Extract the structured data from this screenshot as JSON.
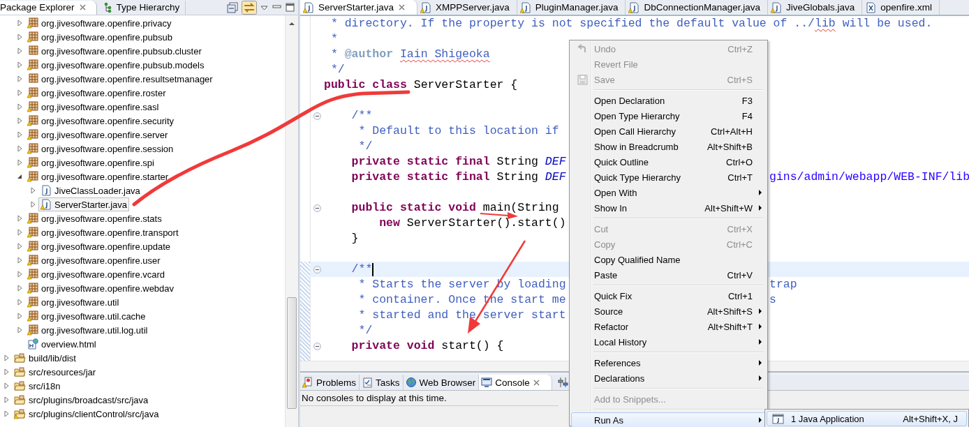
{
  "explorer": {
    "tabs": [
      {
        "label": "Package Explorer",
        "selected": true,
        "closable": true
      },
      {
        "label": "Type Hierarchy",
        "selected": false,
        "closable": false
      }
    ],
    "tree": {
      "continued_children": [
        {
          "kind": "package",
          "label": "org.jivesoftware.openfire.privacy",
          "warning": true,
          "expanded": false,
          "selected": false
        },
        {
          "kind": "package",
          "label": "org.jivesoftware.openfire.pubsub",
          "warning": true,
          "expanded": false,
          "selected": false
        },
        {
          "kind": "package",
          "label": "org.jivesoftware.openfire.pubsub.cluster",
          "warning": false,
          "expanded": false,
          "selected": false
        },
        {
          "kind": "package",
          "label": "org.jivesoftware.openfire.pubsub.models",
          "warning": true,
          "expanded": false,
          "selected": false
        },
        {
          "kind": "package",
          "label": "org.jivesoftware.openfire.resultsetmanager",
          "warning": false,
          "expanded": false,
          "selected": false
        },
        {
          "kind": "package",
          "label": "org.jivesoftware.openfire.roster",
          "warning": true,
          "expanded": false,
          "selected": false
        },
        {
          "kind": "package",
          "label": "org.jivesoftware.openfire.sasl",
          "warning": true,
          "expanded": false,
          "selected": false
        },
        {
          "kind": "package",
          "label": "org.jivesoftware.openfire.security",
          "warning": true,
          "expanded": false,
          "selected": false
        },
        {
          "kind": "package",
          "label": "org.jivesoftware.openfire.server",
          "warning": true,
          "expanded": false,
          "selected": false
        },
        {
          "kind": "package",
          "label": "org.jivesoftware.openfire.session",
          "warning": true,
          "expanded": false,
          "selected": false
        },
        {
          "kind": "package",
          "label": "org.jivesoftware.openfire.spi",
          "warning": true,
          "expanded": false,
          "selected": false
        },
        {
          "kind": "package",
          "label": "org.jivesoftware.openfire.starter",
          "warning": true,
          "expanded": true,
          "selected": false,
          "children": [
            {
              "kind": "java",
              "label": "JiveClassLoader.java",
              "warning": false,
              "expanded": false,
              "selected": false
            },
            {
              "kind": "java",
              "label": "ServerStarter.java",
              "warning": true,
              "expanded": false,
              "selected": true
            }
          ]
        },
        {
          "kind": "package",
          "label": "org.jivesoftware.openfire.stats",
          "warning": true,
          "expanded": false,
          "selected": false
        },
        {
          "kind": "package",
          "label": "org.jivesoftware.openfire.transport",
          "warning": true,
          "expanded": false,
          "selected": false
        },
        {
          "kind": "package",
          "label": "org.jivesoftware.openfire.update",
          "warning": true,
          "expanded": false,
          "selected": false
        },
        {
          "kind": "package",
          "label": "org.jivesoftware.openfire.user",
          "warning": true,
          "expanded": false,
          "selected": false
        },
        {
          "kind": "package",
          "label": "org.jivesoftware.openfire.vcard",
          "warning": true,
          "expanded": false,
          "selected": false
        },
        {
          "kind": "package",
          "label": "org.jivesoftware.openfire.webdav",
          "warning": true,
          "expanded": false,
          "selected": false
        },
        {
          "kind": "package",
          "label": "org.jivesoftware.util",
          "warning": true,
          "expanded": false,
          "selected": false
        },
        {
          "kind": "package",
          "label": "org.jivesoftware.util.cache",
          "warning": true,
          "expanded": false,
          "selected": false
        },
        {
          "kind": "package",
          "label": "org.jivesoftware.util.log.util",
          "warning": true,
          "expanded": false,
          "selected": false
        },
        {
          "kind": "html",
          "label": "overview.html",
          "selected": false
        }
      ],
      "items": [
        {
          "kind": "folder",
          "label": "build/lib/dist",
          "warning": false,
          "expanded": false,
          "selected": false
        },
        {
          "kind": "folder",
          "label": "src/resources/jar",
          "warning": false,
          "expanded": false,
          "selected": false
        },
        {
          "kind": "folder",
          "label": "src/i18n",
          "warning": false,
          "expanded": false,
          "selected": false
        },
        {
          "kind": "folder",
          "label": "src/plugins/broadcast/src/java",
          "warning": false,
          "expanded": false,
          "selected": false
        },
        {
          "kind": "folder",
          "label": "src/plugins/clientControl/src/java",
          "warning": true,
          "expanded": false,
          "selected": false
        }
      ]
    }
  },
  "editor": {
    "tabs": [
      {
        "label": "ServerStarter.java",
        "kind": "java",
        "warning": true,
        "selected": true,
        "closable": true
      },
      {
        "label": "XMPPServer.java",
        "kind": "java",
        "warning": true,
        "selected": false,
        "closable": false
      },
      {
        "label": "PluginManager.java",
        "kind": "java",
        "warning": true,
        "selected": false,
        "closable": false
      },
      {
        "label": "DbConnectionManager.java",
        "kind": "java",
        "warning": true,
        "selected": false,
        "closable": false
      },
      {
        "label": "JiveGlobals.java",
        "kind": "java",
        "warning": true,
        "selected": false,
        "closable": false
      },
      {
        "label": "openfire.xml",
        "kind": "xml",
        "warning": false,
        "selected": false,
        "closable": false
      }
    ],
    "lines": [
      {
        "kind": "code",
        "fold": false,
        "current": false,
        "tokens": [
          {
            "kind": "comment",
            "text": " * directory. If the property is not specified the default value of ../"
          },
          {
            "kind": "comment-spell",
            "text": "lib"
          },
          {
            "kind": "comment",
            "text": " will be used."
          }
        ]
      },
      {
        "kind": "code",
        "fold": false,
        "current": false,
        "tokens": [
          {
            "kind": "comment",
            "text": " *"
          }
        ]
      },
      {
        "kind": "code",
        "fold": false,
        "current": false,
        "tokens": [
          {
            "kind": "comment",
            "text": " * "
          },
          {
            "kind": "tag",
            "text": "@author "
          },
          {
            "kind": "comment-spell",
            "text": "Iain Shigeoka"
          }
        ]
      },
      {
        "kind": "code",
        "fold": false,
        "current": false,
        "tokens": [
          {
            "kind": "comment",
            "text": " */"
          }
        ]
      },
      {
        "kind": "code",
        "fold": false,
        "current": false,
        "tokens": [
          {
            "kind": "keyword",
            "text": "public class"
          },
          {
            "kind": "plain",
            "text": " ServerStarter {"
          }
        ]
      },
      {
        "kind": "blank"
      },
      {
        "kind": "code",
        "fold": true,
        "current": false,
        "tokens": [
          {
            "kind": "comment",
            "text": "    /**"
          }
        ]
      },
      {
        "kind": "code",
        "fold": false,
        "current": false,
        "tokens": [
          {
            "kind": "comment",
            "text": "     * Default to this location if"
          }
        ]
      },
      {
        "kind": "code",
        "fold": false,
        "current": false,
        "tokens": [
          {
            "kind": "comment",
            "text": "     */"
          }
        ]
      },
      {
        "kind": "code",
        "fold": false,
        "current": false,
        "tokens": [
          {
            "kind": "keyword",
            "text": "    private static final"
          },
          {
            "kind": "plain",
            "text": " String "
          },
          {
            "kind": "field",
            "text": "DEF"
          }
        ]
      },
      {
        "kind": "code",
        "fold": false,
        "current": false,
        "tokens": [
          {
            "kind": "keyword",
            "text": "    private static final"
          },
          {
            "kind": "plain",
            "text": " String "
          },
          {
            "kind": "field",
            "text": "DEF"
          }
        ],
        "right": [
          {
            "kind": "string",
            "text": "gins/admin/webapp/WEB-INF/lib"
          }
        ]
      },
      {
        "kind": "blank"
      },
      {
        "kind": "code",
        "fold": true,
        "current": false,
        "tokens": [
          {
            "kind": "keyword",
            "text": "    public static void"
          },
          {
            "kind": "plain",
            "text": " main(String"
          }
        ]
      },
      {
        "kind": "code",
        "fold": false,
        "current": false,
        "tokens": [
          {
            "kind": "keyword",
            "text": "        new"
          },
          {
            "kind": "plain",
            "text": " ServerStarter().start()"
          }
        ]
      },
      {
        "kind": "code",
        "fold": false,
        "current": false,
        "tokens": [
          {
            "kind": "plain",
            "text": "    }"
          }
        ]
      },
      {
        "kind": "blank"
      },
      {
        "kind": "code",
        "fold": true,
        "current": true,
        "tokens": [
          {
            "kind": "comment",
            "text": "    /**"
          }
        ]
      },
      {
        "kind": "code",
        "fold": false,
        "current": false,
        "tokens": [
          {
            "kind": "comment",
            "text": "     * Starts the server by loading"
          }
        ],
        "right": [
          {
            "kind": "comment",
            "text": "trap"
          }
        ]
      },
      {
        "kind": "code",
        "fold": false,
        "current": false,
        "tokens": [
          {
            "kind": "comment",
            "text": "     * container. Once the start me"
          }
        ],
        "right": [
          {
            "kind": "comment",
            "text": "s"
          }
        ]
      },
      {
        "kind": "code",
        "fold": false,
        "current": false,
        "tokens": [
          {
            "kind": "comment",
            "text": "     * started and the server start"
          }
        ]
      },
      {
        "kind": "code",
        "fold": false,
        "current": false,
        "tokens": [
          {
            "kind": "comment",
            "text": "     */"
          }
        ]
      },
      {
        "kind": "code",
        "fold": true,
        "current": false,
        "tokens": [
          {
            "kind": "keyword",
            "text": "    private void"
          },
          {
            "kind": "plain",
            "text": " start() {"
          }
        ]
      }
    ]
  },
  "bottom_panel": {
    "tabs": [
      {
        "label": "Problems",
        "selected": false,
        "closable": false
      },
      {
        "label": "Tasks",
        "selected": false,
        "closable": false
      },
      {
        "label": "Web Browser",
        "selected": false,
        "closable": false
      },
      {
        "label": "Console",
        "selected": true,
        "closable": true
      }
    ],
    "message": "No consoles to display at this time."
  },
  "context_menu": {
    "items": [
      {
        "kind": "item",
        "label": "Undo",
        "shortcut": "Ctrl+Z",
        "disabled": true,
        "submenu": false,
        "selected": false
      },
      {
        "kind": "item",
        "label": "Revert File",
        "disabled": true,
        "submenu": false,
        "selected": false
      },
      {
        "kind": "item",
        "label": "Save",
        "shortcut": "Ctrl+S",
        "disabled": true,
        "submenu": false,
        "selected": false
      },
      {
        "kind": "separator"
      },
      {
        "kind": "item",
        "label": "Open Declaration",
        "shortcut": "F3",
        "disabled": false,
        "submenu": false,
        "selected": false
      },
      {
        "kind": "item",
        "label": "Open Type Hierarchy",
        "shortcut": "F4",
        "disabled": false,
        "submenu": false,
        "selected": false
      },
      {
        "kind": "item",
        "label": "Open Call Hierarchy",
        "shortcut": "Ctrl+Alt+H",
        "disabled": false,
        "submenu": false,
        "selected": false
      },
      {
        "kind": "item",
        "label": "Show in Breadcrumb",
        "shortcut": "Alt+Shift+B",
        "disabled": false,
        "submenu": false,
        "selected": false
      },
      {
        "kind": "item",
        "label": "Quick Outline",
        "shortcut": "Ctrl+O",
        "disabled": false,
        "submenu": false,
        "selected": false
      },
      {
        "kind": "item",
        "label": "Quick Type Hierarchy",
        "shortcut": "Ctrl+T",
        "disabled": false,
        "submenu": false,
        "selected": false
      },
      {
        "kind": "item",
        "label": "Open With",
        "disabled": false,
        "submenu": true,
        "selected": false
      },
      {
        "kind": "item",
        "label": "Show In",
        "shortcut": "Alt+Shift+W",
        "disabled": false,
        "submenu": true,
        "selected": false
      },
      {
        "kind": "separator"
      },
      {
        "kind": "item",
        "label": "Cut",
        "shortcut": "Ctrl+X",
        "disabled": true,
        "submenu": false,
        "selected": false
      },
      {
        "kind": "item",
        "label": "Copy",
        "shortcut": "Ctrl+C",
        "disabled": true,
        "submenu": false,
        "selected": false
      },
      {
        "kind": "item",
        "label": "Copy Qualified Name",
        "disabled": false,
        "submenu": false,
        "selected": false
      },
      {
        "kind": "item",
        "label": "Paste",
        "shortcut": "Ctrl+V",
        "disabled": false,
        "submenu": false,
        "selected": false
      },
      {
        "kind": "separator"
      },
      {
        "kind": "item",
        "label": "Quick Fix",
        "shortcut": "Ctrl+1",
        "disabled": false,
        "submenu": false,
        "selected": false
      },
      {
        "kind": "item",
        "label": "Source",
        "shortcut": "Alt+Shift+S",
        "disabled": false,
        "submenu": true,
        "selected": false
      },
      {
        "kind": "item",
        "label": "Refactor",
        "shortcut": "Alt+Shift+T",
        "disabled": false,
        "submenu": true,
        "selected": false
      },
      {
        "kind": "item",
        "label": "Local History",
        "disabled": false,
        "submenu": true,
        "selected": false
      },
      {
        "kind": "separator"
      },
      {
        "kind": "item",
        "label": "References",
        "disabled": false,
        "submenu": true,
        "selected": false
      },
      {
        "kind": "item",
        "label": "Declarations",
        "disabled": false,
        "submenu": true,
        "selected": false
      },
      {
        "kind": "separator"
      },
      {
        "kind": "item",
        "label": "Add to Snippets...",
        "disabled": true,
        "submenu": false,
        "selected": false
      },
      {
        "kind": "separator"
      },
      {
        "kind": "item",
        "label": "Run As",
        "disabled": false,
        "submenu": true,
        "selected": true
      }
    ]
  },
  "submenu": {
    "items": [
      {
        "label": "1 Java Application",
        "shortcut": "Alt+Shift+X, J",
        "selected": true
      }
    ]
  }
}
